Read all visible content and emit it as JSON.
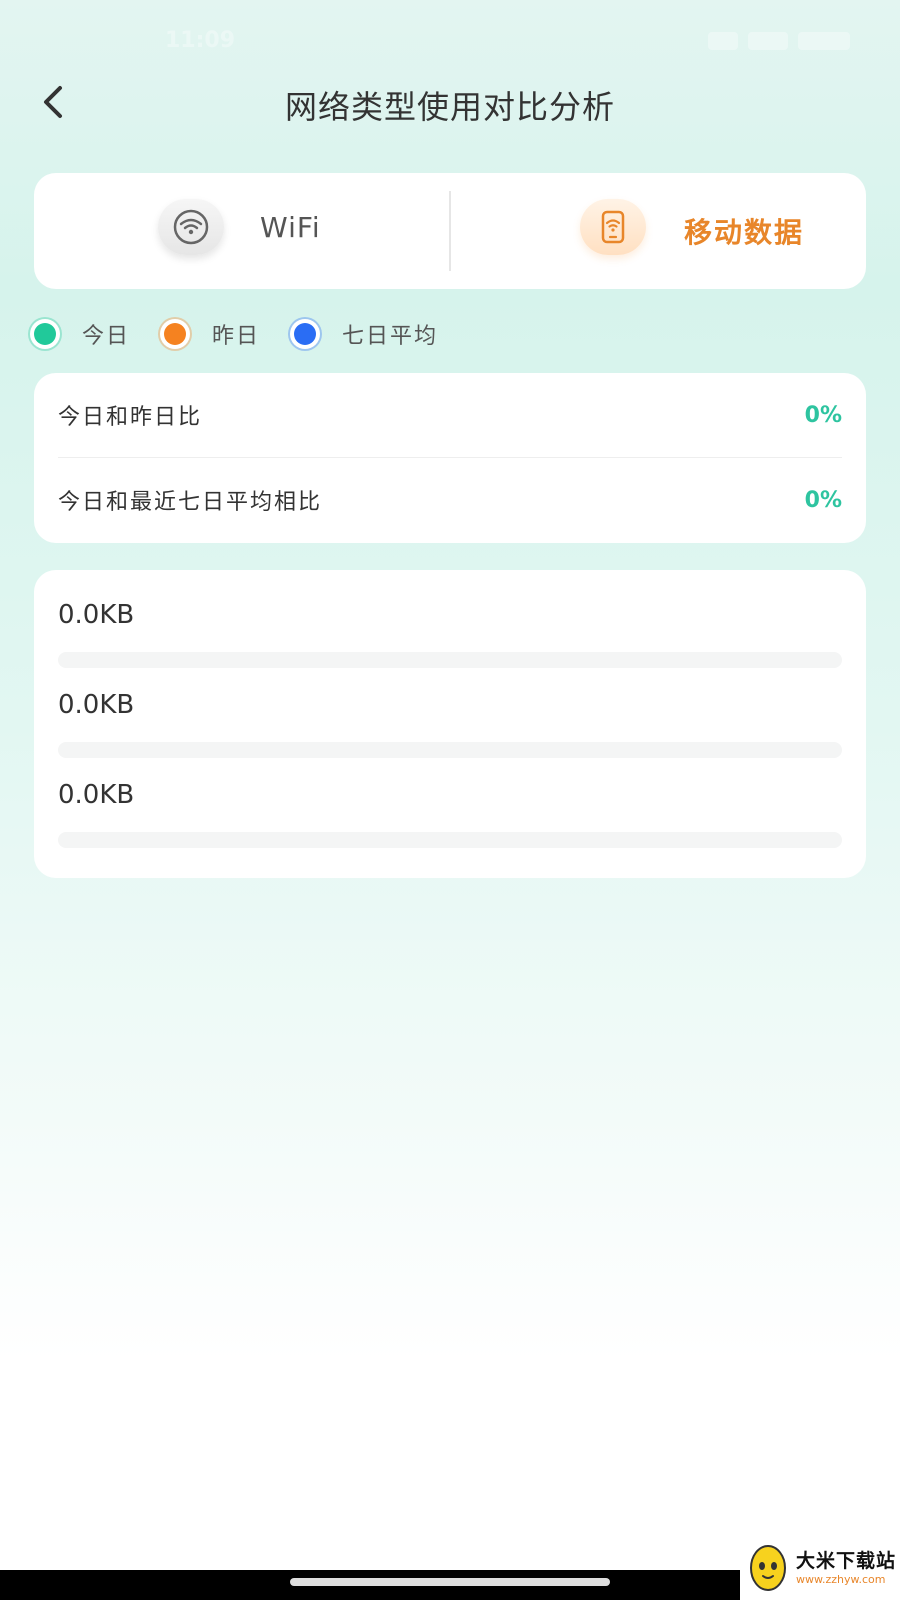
{
  "status_bar": {
    "time": "11:09"
  },
  "header": {
    "back_icon": "chevron-left-icon",
    "title": "网络类型使用对比分析"
  },
  "tabs": [
    {
      "label": "WiFi",
      "icon": "wifi-icon",
      "selected": false,
      "color": "#555555"
    },
    {
      "label": "移动数据",
      "icon": "mobile-data-icon",
      "selected": true,
      "color": "#e8862a"
    }
  ],
  "legend": [
    {
      "label": "今日",
      "color": "#21c99a"
    },
    {
      "label": "昨日",
      "color": "#f58220"
    },
    {
      "label": "七日平均",
      "color": "#2a6df4"
    }
  ],
  "comparison": [
    {
      "label": "今日和昨日比",
      "value": "0%"
    },
    {
      "label": "今日和最近七日平均相比",
      "value": "0%"
    }
  ],
  "usage": [
    {
      "series": "今日",
      "value_text": "0.0KB",
      "fraction": 0,
      "color": "#21c99a"
    },
    {
      "series": "昨日",
      "value_text": "0.0KB",
      "fraction": 0,
      "color": "#f58220"
    },
    {
      "series": "七日平均",
      "value_text": "0.0KB",
      "fraction": 0,
      "color": "#2a6df4"
    }
  ],
  "watermark": {
    "title": "大米下载站",
    "url": "www.zzhyw.com"
  }
}
